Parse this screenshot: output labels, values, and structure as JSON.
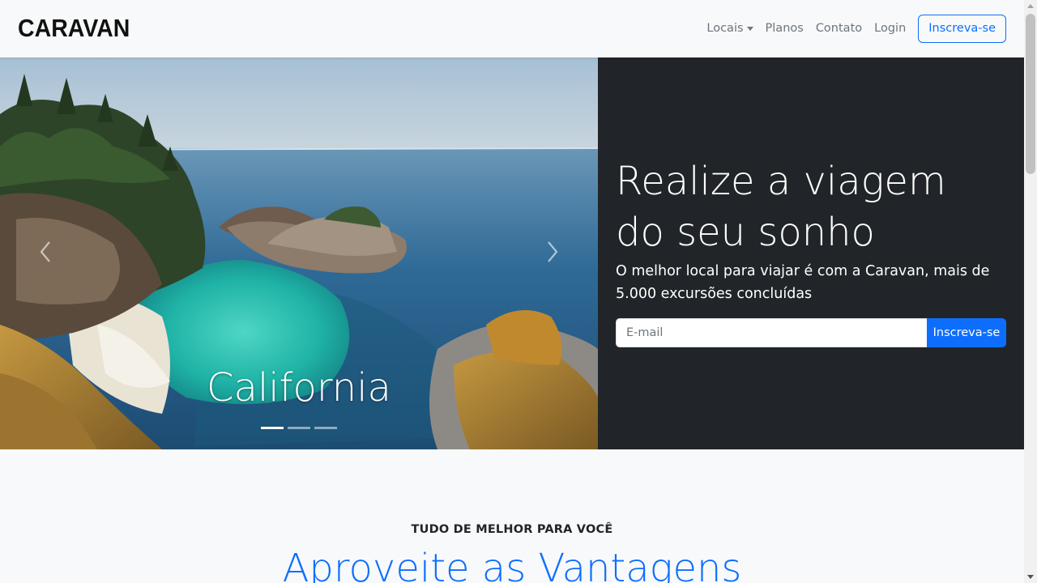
{
  "navbar": {
    "brand": "CARAVAN",
    "links": [
      {
        "label": "Locais",
        "dropdown": true
      },
      {
        "label": "Planos"
      },
      {
        "label": "Contato"
      },
      {
        "label": "Login"
      }
    ],
    "signup_label": "Inscreva-se"
  },
  "carousel": {
    "caption": "California",
    "slide_count": 3,
    "active_slide": 1,
    "prev_icon": "chevron-left-icon",
    "next_icon": "chevron-right-icon"
  },
  "hero": {
    "title": "Realize a viagem do seu sonho",
    "subtitle": "O melhor local para viajar é com a Caravan, mais de 5.000 excursões concluídas",
    "email_placeholder": "E-mail",
    "email_value": "",
    "submit_label": "Inscreva-se"
  },
  "benefits": {
    "kicker": "TUDO DE MELHOR PARA VOCÊ",
    "title": "Aproveite as Vantagens"
  },
  "colors": {
    "primary": "#0d6efd",
    "dark_panel": "#212529",
    "background": "#f8f9fa",
    "muted_text": "#6c757d"
  }
}
